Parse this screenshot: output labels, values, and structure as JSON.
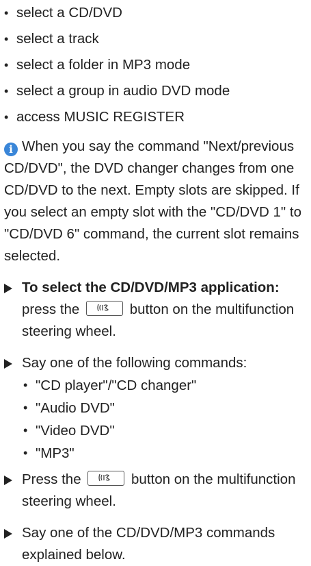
{
  "intro_bullets": [
    "select a CD/DVD",
    "select a track",
    "select a folder in MP3 mode",
    "select a group in audio DVD mode",
    "access MUSIC REGISTER"
  ],
  "note": {
    "icon": "info-icon",
    "text": "When you say the command \"Next/pre­vious CD/DVD\", the DVD changer changes from one CD/DVD to the next. Empty slots are skipped. If you select an empty slot with the \"CD/DVD 1\" to \"CD/DVD 6\" command, the current slot remains selected."
  },
  "steps": [
    {
      "bold": "To select the CD/DVD/MP3 applica­tion:",
      "before_key": " press the",
      "key_icon": "voice-control-icon",
      "after_key": "button on the multi­function steering wheel."
    },
    {
      "text": "Say one of the following commands:",
      "sub_items": [
        "\"CD player\"/\"CD changer\"",
        "\"Audio DVD\"",
        "\"Video DVD\"",
        "\"MP3\""
      ]
    },
    {
      "before_key": "Press the",
      "key_icon": "voice-control-icon",
      "after_key": "button on the multifunction steering wheel."
    },
    {
      "text": "Say one of the CD/DVD/MP3 commands explained below."
    }
  ]
}
